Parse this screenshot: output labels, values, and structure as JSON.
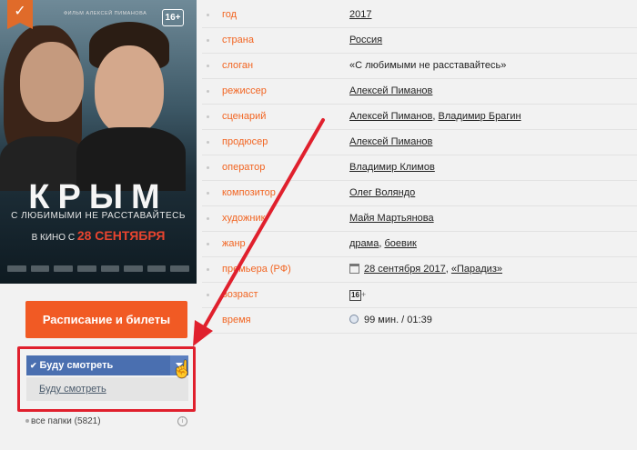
{
  "poster": {
    "small_text": "ФИЛЬМ АЛЕКСЕЙ ПИМАНОВА",
    "age_badge": "16+",
    "title": "КРЫМ",
    "tagline": "С ЛЮБИМЫМИ НЕ РАССТАВАЙТЕСЬ",
    "release_prefix": "В КИНО С",
    "release_date": "28 СЕНТЯБРЯ",
    "bookmark_icon": "check-bookmark-icon"
  },
  "actions": {
    "schedule_button": "Расписание и билеты"
  },
  "watchlist": {
    "selected_label": "Буду смотреть",
    "option_label": "Буду смотреть",
    "folders_label": "все папки (5821)"
  },
  "info": {
    "rows": [
      {
        "label": "год",
        "value": "2017"
      },
      {
        "label": "страна",
        "value": "Россия"
      },
      {
        "label": "слоган",
        "value": "«С любимыми не расставайтесь»"
      },
      {
        "label": "режиссер",
        "value": "Алексей Пиманов"
      },
      {
        "label": "сценарий",
        "value": "Алексей Пиманов",
        "value2": "Владимир Брагин"
      },
      {
        "label": "продюсер",
        "value": "Алексей Пиманов"
      },
      {
        "label": "оператор",
        "value": "Владимир Климов"
      },
      {
        "label": "композитор",
        "value": "Олег Воляндо"
      },
      {
        "label": "художник",
        "value": "Майя Мартьянова"
      },
      {
        "label": "жанр",
        "value": "драма",
        "value2": "боевик"
      },
      {
        "label": "премьера (РФ)",
        "value": "28 сентября 2017",
        "value2": "«Парадиз»"
      },
      {
        "label": "возраст",
        "value": "16",
        "value2": "+"
      },
      {
        "label": "время",
        "value": "99 мин. / 01:39"
      }
    ]
  },
  "annotation": {
    "color": "#e0202d"
  }
}
